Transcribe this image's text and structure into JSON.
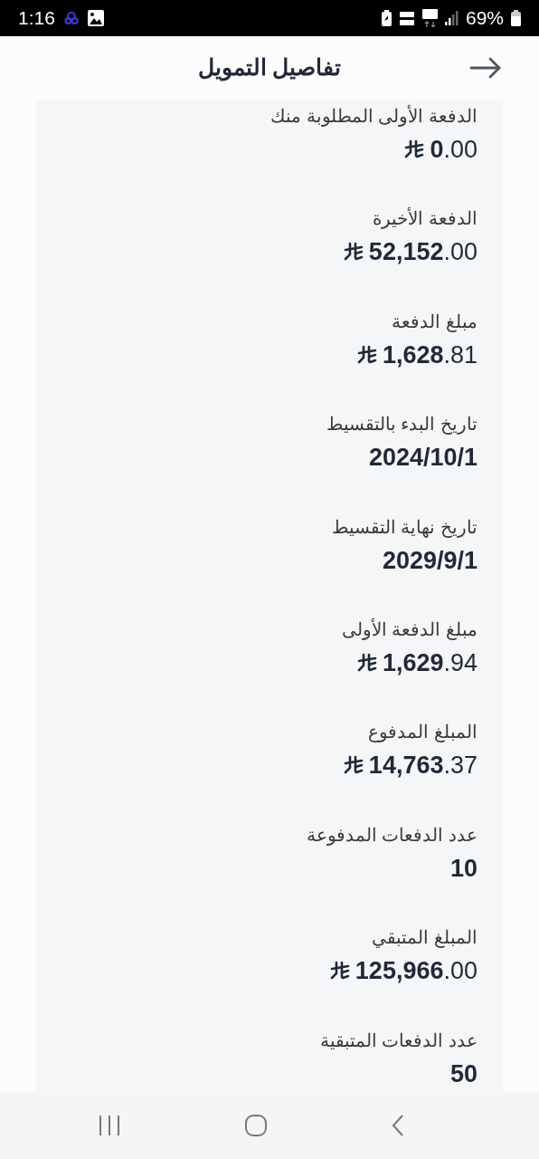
{
  "status_bar": {
    "time": "1:16",
    "battery": "69%"
  },
  "header": {
    "title": "تفاصيل التمويل"
  },
  "details": [
    {
      "label": "الدفعة الأولى المطلوبة منك",
      "value": "**0**.00",
      "kind": "amount"
    },
    {
      "label": "الدفعة الأخيرة",
      "value": "**52,152**.00",
      "kind": "amount"
    },
    {
      "label": "مبلغ الدفعة",
      "value": "**1,628**.81",
      "kind": "amount"
    },
    {
      "label": "تاريخ البدء بالتقسيط",
      "value": "2024/10/1",
      "kind": "date"
    },
    {
      "label": "تاريخ نهاية التقسيط",
      "value": "2029/9/1",
      "kind": "date"
    },
    {
      "label": "مبلغ الدفعة الأولى",
      "value": "**1,629**.94",
      "kind": "amount"
    },
    {
      "label": "المبلغ المدفوع",
      "value": "**14,763**.37",
      "kind": "amount"
    },
    {
      "label": "عدد الدفعات المدفوعة",
      "value": "10",
      "kind": "count"
    },
    {
      "label": "المبلغ المتبقي",
      "value": "**125,966**.00",
      "kind": "amount"
    },
    {
      "label": "عدد الدفعات المتبقية",
      "value": "50",
      "kind": "count"
    }
  ]
}
